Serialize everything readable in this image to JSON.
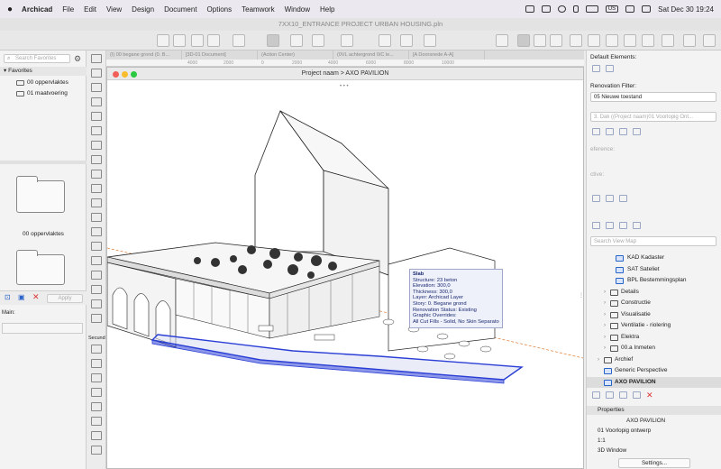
{
  "menubar": {
    "app": "Archicad",
    "items": [
      "File",
      "Edit",
      "View",
      "Design",
      "Document",
      "Options",
      "Teamwork",
      "Window",
      "Help"
    ],
    "input_source": "US",
    "clock": "Sat Dec 30  19:24"
  },
  "window": {
    "title": "7XX10_ENTRANCE PROJECT URBAN HOUSING.pln"
  },
  "tabs": [
    "(I) 00 begane grond (0. B...",
    "[3D-01 Document]",
    "(Action Center)",
    "(0VL achtergrond 0/C le...",
    "[A Doorsnede A-A]"
  ],
  "ruler": [
    "4000",
    "2000",
    "0",
    "2000",
    "4000",
    "6000",
    "8000",
    "10000"
  ],
  "navigator": {
    "search_placeholder": "Search Favorites",
    "favorites_title": "Favorites",
    "favorites": [
      "00 oppervlaktes",
      "01 maatvoering"
    ],
    "preview_label": "00 oppervlaktes",
    "apply": "Apply",
    "main_label": "Main:"
  },
  "toolbox": {
    "section_label": "Secund"
  },
  "view3d": {
    "path": "Project naam  >  AXO PAVILION",
    "tooltip": {
      "title": "Slab",
      "lines": [
        "Structure: 23 beton",
        "Elevation: 300,0",
        "Thickness: 300,0",
        "Layer: Archicad Layer",
        "Story: 0. Begane grond",
        "Renovation Status: Existing",
        "Graphic Overrides:",
        "All Cut Fills - Solid, No Skin Separators"
      ]
    }
  },
  "rightpanel": {
    "default_elements": "Default Elements:",
    "renovation_filter_label": "Renovation Filter:",
    "renovation_filter_value": "05 Nieuwe toestand",
    "view_value": "3. Dak ((Project naam)01 Voorlopig Ont...",
    "reference_label": "eference:",
    "active_label": "ctive:",
    "search_placeholder": "Search View Map",
    "tree": [
      {
        "label": "KAD  Kadaster",
        "indent": 2,
        "chev": "",
        "blue": true
      },
      {
        "label": "SAT Sateliet",
        "indent": 2,
        "chev": "",
        "blue": true
      },
      {
        "label": "BPL Bestemmingsplan",
        "indent": 2,
        "chev": "",
        "blue": true
      },
      {
        "label": "Details",
        "indent": 1,
        "chev": "›",
        "blue": false
      },
      {
        "label": "Constructie",
        "indent": 1,
        "chev": "›",
        "blue": false
      },
      {
        "label": "Visualisatie",
        "indent": 1,
        "chev": "›",
        "blue": false
      },
      {
        "label": "Ventilatie - riolering",
        "indent": 1,
        "chev": "›",
        "blue": false
      },
      {
        "label": "Elektra",
        "indent": 1,
        "chev": "›",
        "blue": false
      },
      {
        "label": "00.a Inmeten",
        "indent": 1,
        "chev": "›",
        "blue": false
      },
      {
        "label": "Archief",
        "indent": 0,
        "chev": "›",
        "blue": false
      },
      {
        "label": "Generic Perspective",
        "indent": 0,
        "chev": "",
        "blue": true
      },
      {
        "label": "AXO PAVILION",
        "indent": 0,
        "chev": "",
        "blue": true,
        "selected": true
      }
    ],
    "properties_title": "Properties",
    "properties": [
      "AXO PAVILION",
      "01 Voorlopig ontwerp",
      "1:1",
      "3D Window"
    ],
    "settings": "Settings..."
  },
  "colors": {
    "selection": "#2b3fd6",
    "tooltip_bg": "#eef0fa",
    "guide": "#e07a2e"
  }
}
